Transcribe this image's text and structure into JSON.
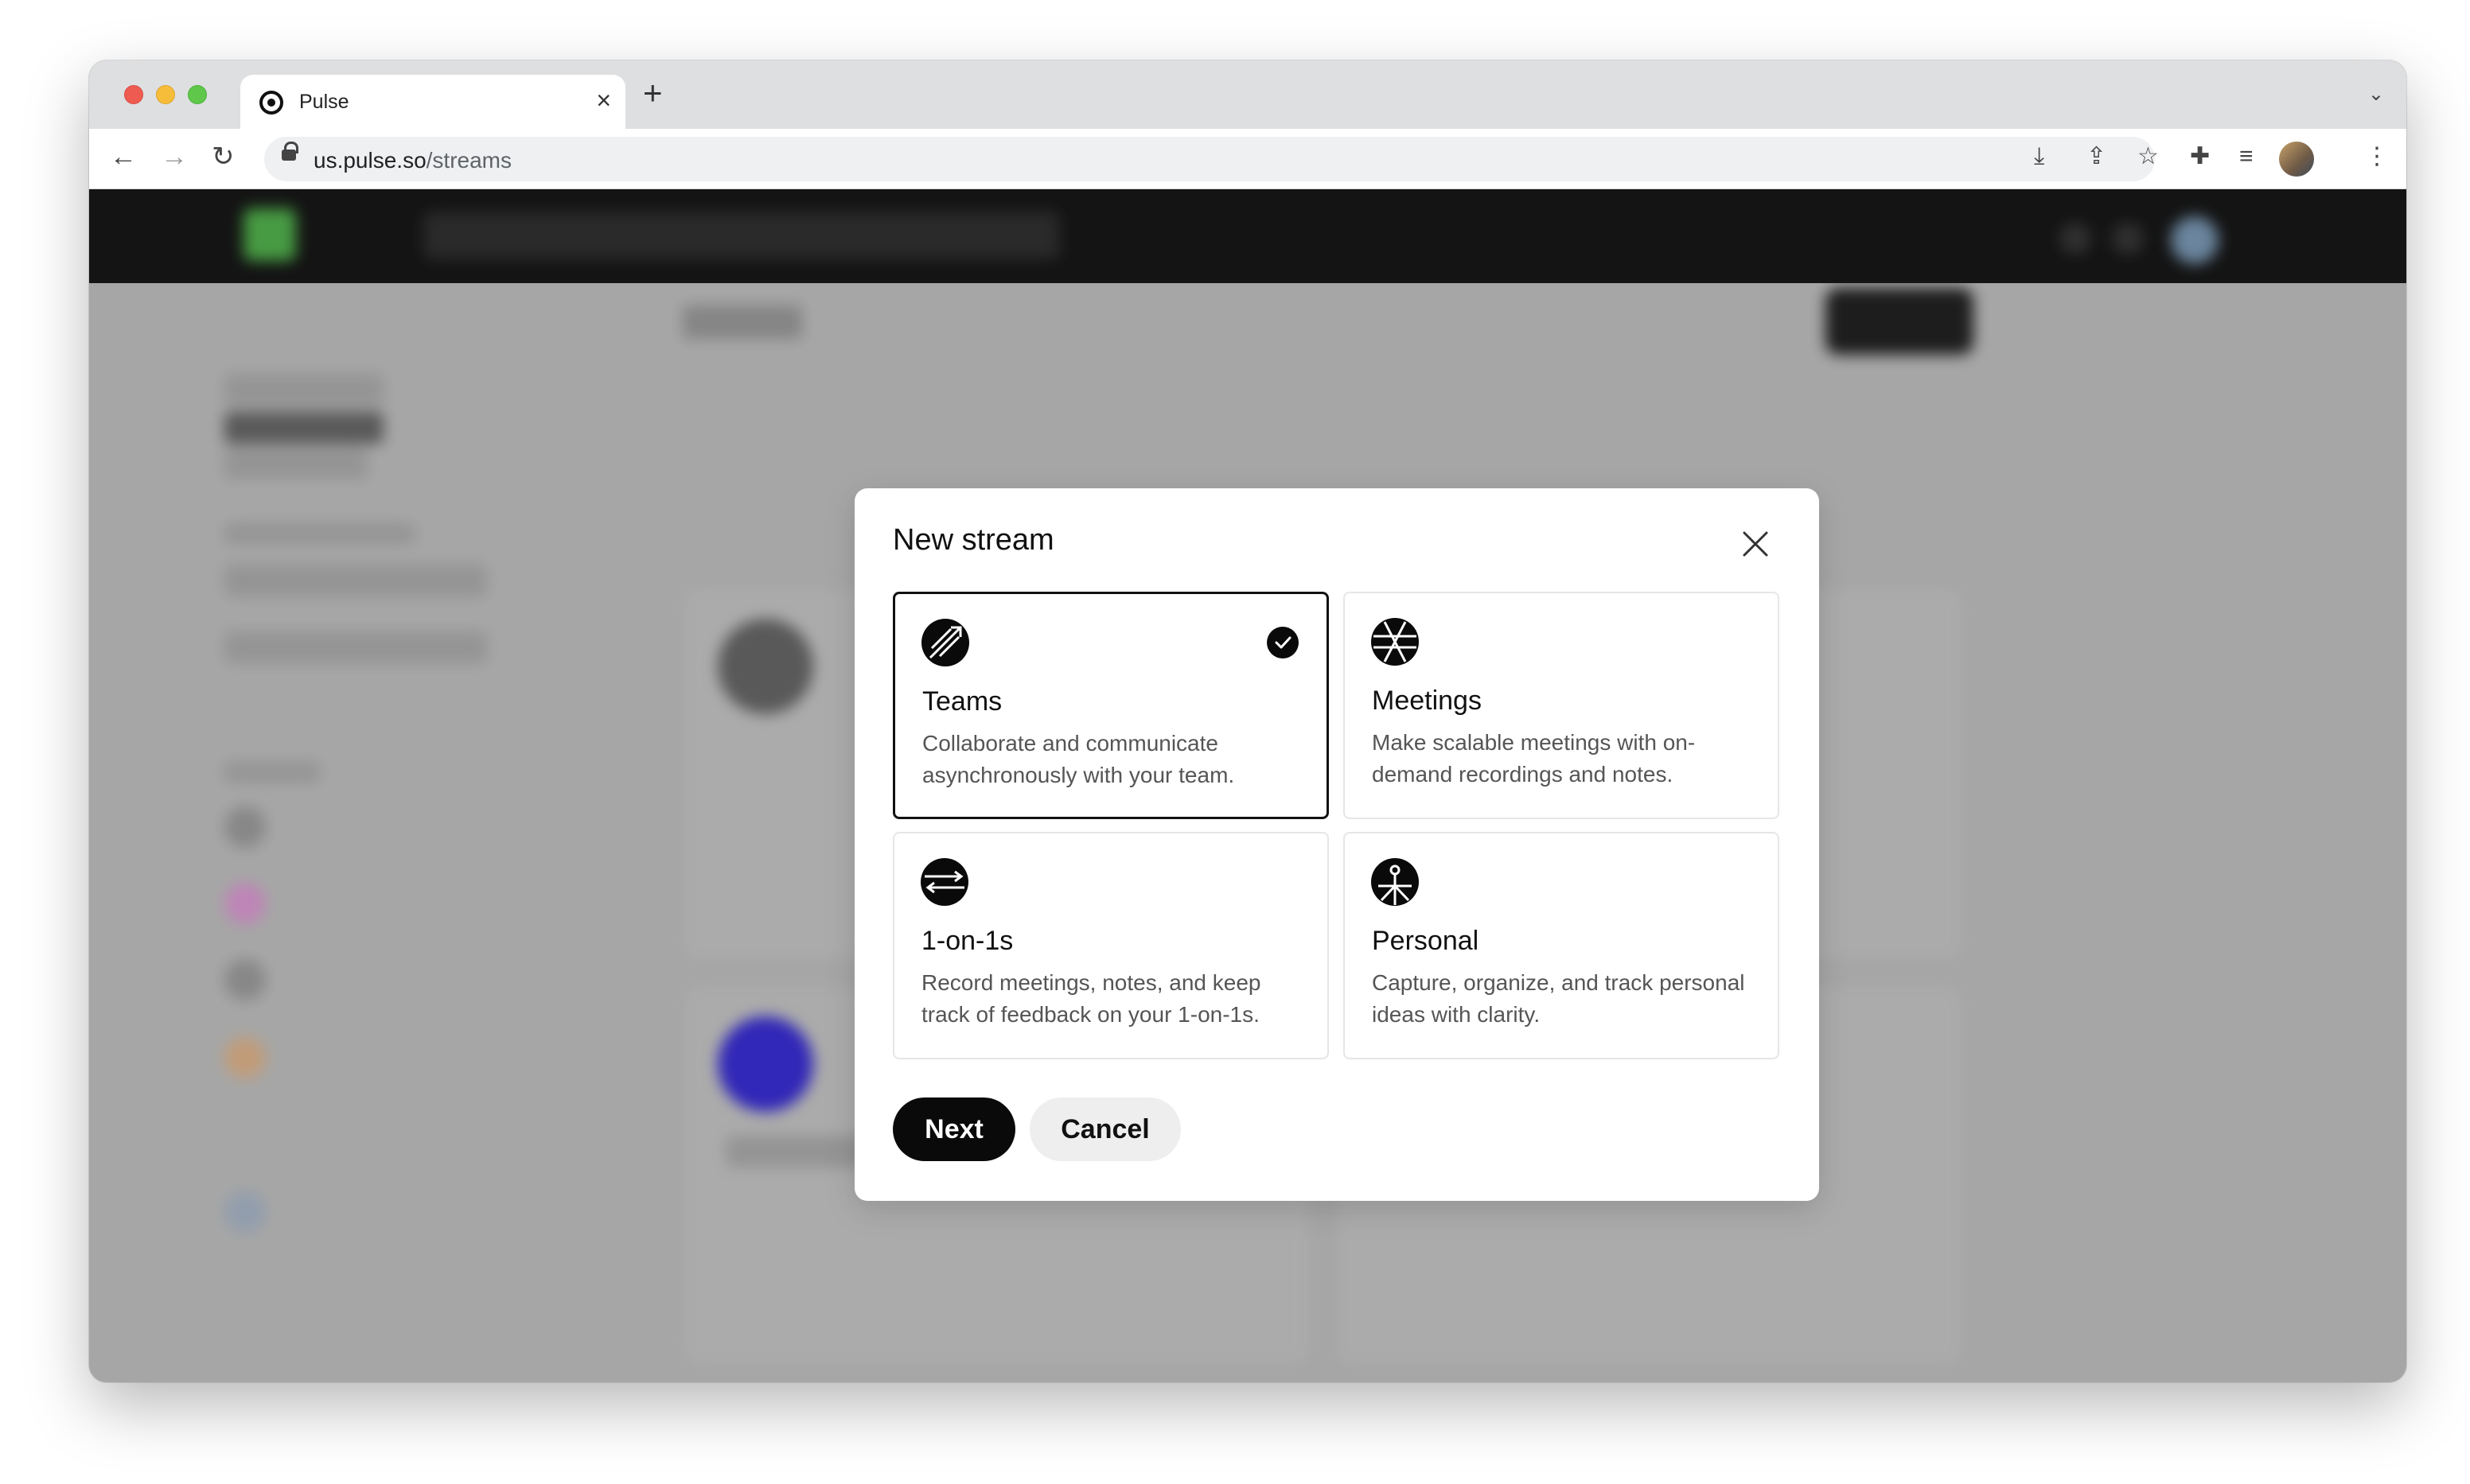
{
  "browser": {
    "tab_title": "Pulse",
    "url_host": "us.pulse.so",
    "url_path": "/streams"
  },
  "modal": {
    "title": "New stream",
    "options": [
      {
        "title": "Teams",
        "description": "Collaborate and communicate asynchronously with your team.",
        "icon": "teams-icon",
        "selected": true
      },
      {
        "title": "Meetings",
        "description": "Make scalable meetings with on-demand recordings and notes.",
        "icon": "meetings-icon",
        "selected": false
      },
      {
        "title": "1-on-1s",
        "description": "Record meetings, notes, and keep track of feedback on your 1-on-1s.",
        "icon": "one-on-one-icon",
        "selected": false
      },
      {
        "title": "Personal",
        "description": "Capture, organize, and track personal ideas with clarity.",
        "icon": "personal-icon",
        "selected": false
      }
    ],
    "next_label": "Next",
    "cancel_label": "Cancel"
  },
  "colors": {
    "primary_button": "#0a0a0a",
    "secondary_button": "#eeeeee",
    "selected_border": "#111111"
  }
}
